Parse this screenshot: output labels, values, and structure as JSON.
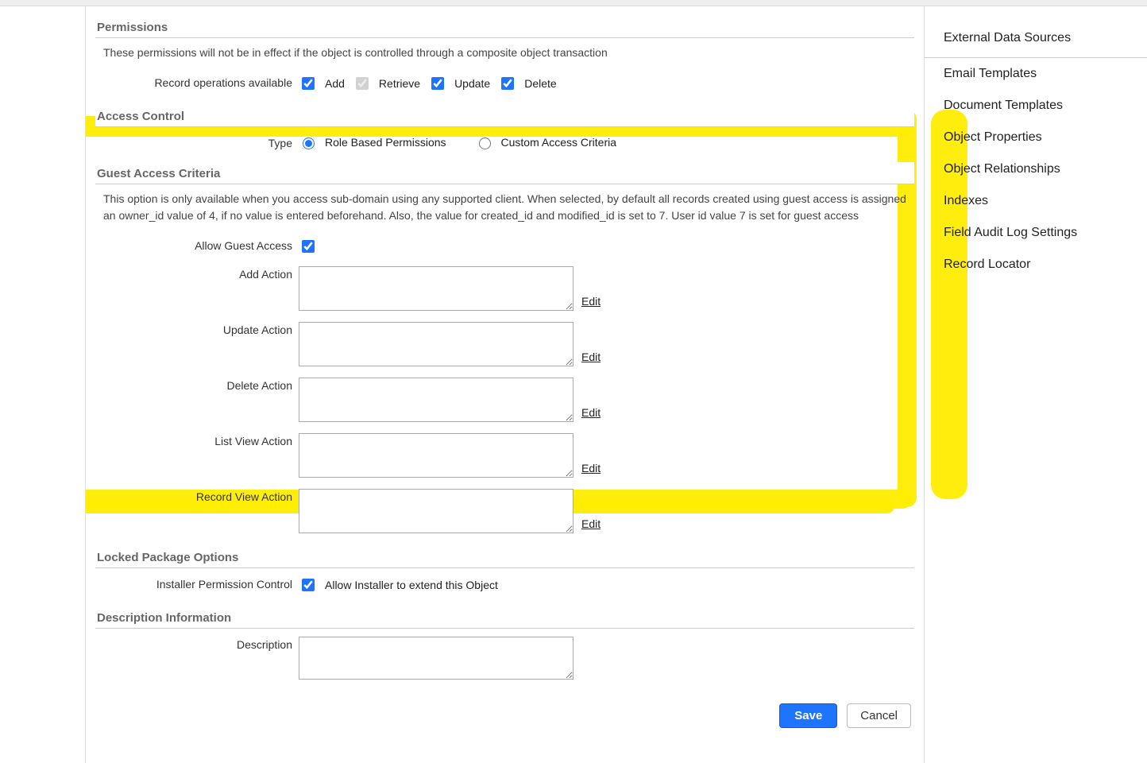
{
  "permissions": {
    "header": "Permissions",
    "note": "These permissions will not be in effect if the object is controlled through a composite object transaction",
    "record_ops_label": "Record operations available",
    "ops": {
      "add": {
        "label": "Add",
        "checked": true,
        "disabled": false
      },
      "retrieve": {
        "label": "Retrieve",
        "checked": true,
        "disabled": true
      },
      "update": {
        "label": "Update",
        "checked": true,
        "disabled": false
      },
      "delete": {
        "label": "Delete",
        "checked": true,
        "disabled": false
      }
    }
  },
  "access_control": {
    "header": "Access Control",
    "type_label": "Type",
    "options": {
      "role": {
        "label": "Role Based Permissions",
        "selected": true
      },
      "custom": {
        "label": "Custom Access Criteria",
        "selected": false
      }
    }
  },
  "guest": {
    "header": "Guest Access Criteria",
    "note": "This option is only available when you access sub-domain using any supported client. When selected, by default all records created using guest access is assigned an owner_id value of 4, if no value is entered beforehand. Also, the value for created_id and modified_id is set to 7. User id value 7 is set for guest access",
    "allow_label": "Allow Guest Access",
    "allow_checked": true,
    "edit_label": "Edit",
    "actions": {
      "add": {
        "label": "Add Action",
        "value": ""
      },
      "update": {
        "label": "Update Action",
        "value": ""
      },
      "delete": {
        "label": "Delete Action",
        "value": ""
      },
      "list_view": {
        "label": "List View Action",
        "value": ""
      },
      "record_view": {
        "label": "Record View Action",
        "value": ""
      }
    }
  },
  "locked_pkg": {
    "header": "Locked Package Options",
    "ctrl_label": "Installer Permission Control",
    "extend_label": "Allow Installer to extend this Object",
    "extend_checked": true
  },
  "description": {
    "header": "Description Information",
    "label": "Description",
    "value": ""
  },
  "buttons": {
    "save": "Save",
    "cancel": "Cancel"
  },
  "side_nav": {
    "items": [
      "External Data Sources",
      "Email Templates",
      "Document Templates",
      "Object Properties",
      "Object Relationships",
      "Indexes",
      "Field Audit Log Settings",
      "Record Locator"
    ],
    "separator_after_index": 0
  }
}
